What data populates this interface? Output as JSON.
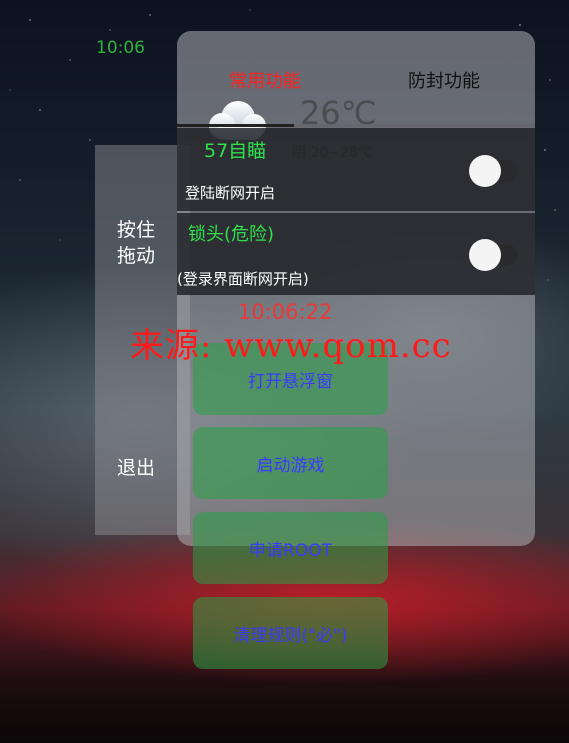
{
  "status_bar": {
    "time": "10:06"
  },
  "side_bar": {
    "drag_label": "按住拖动",
    "exit_label": "退出"
  },
  "tabs": {
    "common": "常用功能",
    "anti_ban": "防封功能"
  },
  "weather": {
    "temperature": "26℃",
    "status": "57自瞄",
    "range": "阴 20~28℃",
    "icon": "cloud-icon"
  },
  "settings": [
    {
      "title": "",
      "subtitle": "登陆断网开启",
      "enabled": false
    },
    {
      "title": "锁头(危险)",
      "subtitle": "(登录界面断网开启)",
      "enabled": false
    }
  ],
  "clock_large": "10:06:22",
  "buttons": {
    "open_float": "打开悬浮窗",
    "start_game": "启动游戏",
    "request_root": "申请ROOT",
    "clean_rules": "清理规则(\"必\")"
  },
  "watermark": "来源: www.qom.cc",
  "colors": {
    "accent_red": "#ff2020",
    "accent_green": "#2ee04a",
    "button_text": "#3a3aff"
  }
}
